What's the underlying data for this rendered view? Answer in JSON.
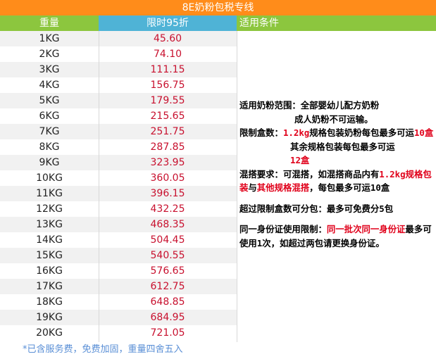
{
  "title": "8E奶粉包税专线",
  "headers": {
    "weight": "重量",
    "price": "限时95折",
    "conditions": "适用条件"
  },
  "rows": [
    {
      "weight": "1KG",
      "price": "45.60"
    },
    {
      "weight": "2KG",
      "price": "74.10"
    },
    {
      "weight": "3KG",
      "price": "111.15"
    },
    {
      "weight": "4KG",
      "price": "156.75"
    },
    {
      "weight": "5KG",
      "price": "179.55"
    },
    {
      "weight": "6KG",
      "price": "215.65"
    },
    {
      "weight": "7KG",
      "price": "251.75"
    },
    {
      "weight": "8KG",
      "price": "287.85"
    },
    {
      "weight": "9KG",
      "price": "323.95"
    },
    {
      "weight": "10KG",
      "price": "360.05"
    },
    {
      "weight": "11KG",
      "price": "396.15"
    },
    {
      "weight": "12KG",
      "price": "432.25"
    },
    {
      "weight": "13KG",
      "price": "468.35"
    },
    {
      "weight": "14KG",
      "price": "504.45"
    },
    {
      "weight": "15KG",
      "price": "540.55"
    },
    {
      "weight": "16KG",
      "price": "576.65"
    },
    {
      "weight": "17KG",
      "price": "612.75"
    },
    {
      "weight": "18KG",
      "price": "648.85"
    },
    {
      "weight": "19KG",
      "price": "684.95"
    },
    {
      "weight": "20KG",
      "price": "721.05"
    }
  ],
  "conditions": {
    "scope_line1": "适用奶粉范围：全部婴幼儿配方奶粉",
    "scope_line2": "成人奶粉不可运输。",
    "limit_a": "限制盒数：",
    "limit_b": "1.2kg",
    "limit_c": "规格包装奶粉每包最多可运",
    "limit_d": "10盒",
    "limit_e": "其余规格包装每包最多可运",
    "limit_f": "12盒",
    "mix_a": "混搭要求：可混搭，如混搭商品内有",
    "mix_b": "1.2kg规格包装",
    "mix_c": "与",
    "mix_d": "其他规格混搭",
    "mix_e": "，每包最多可运10盒",
    "split": "超过限制盒数可分包：最多可免费分5包",
    "id_a": "同一身份证使用限制：",
    "id_b": "同一批次同一身份证",
    "id_c": "最多可使用1次，如超过两包请更换身份证。"
  },
  "footnote": "*已含服务费，免费加固，重量四舍五入",
  "colors": {
    "title_bg": "#ff8c1a",
    "header_green": "#8cc63e",
    "header_blue": "#4fb3d6",
    "price_red": "#c8102e",
    "highlight_red": "#e0001a",
    "footnote_blue": "#5a8fd6"
  }
}
